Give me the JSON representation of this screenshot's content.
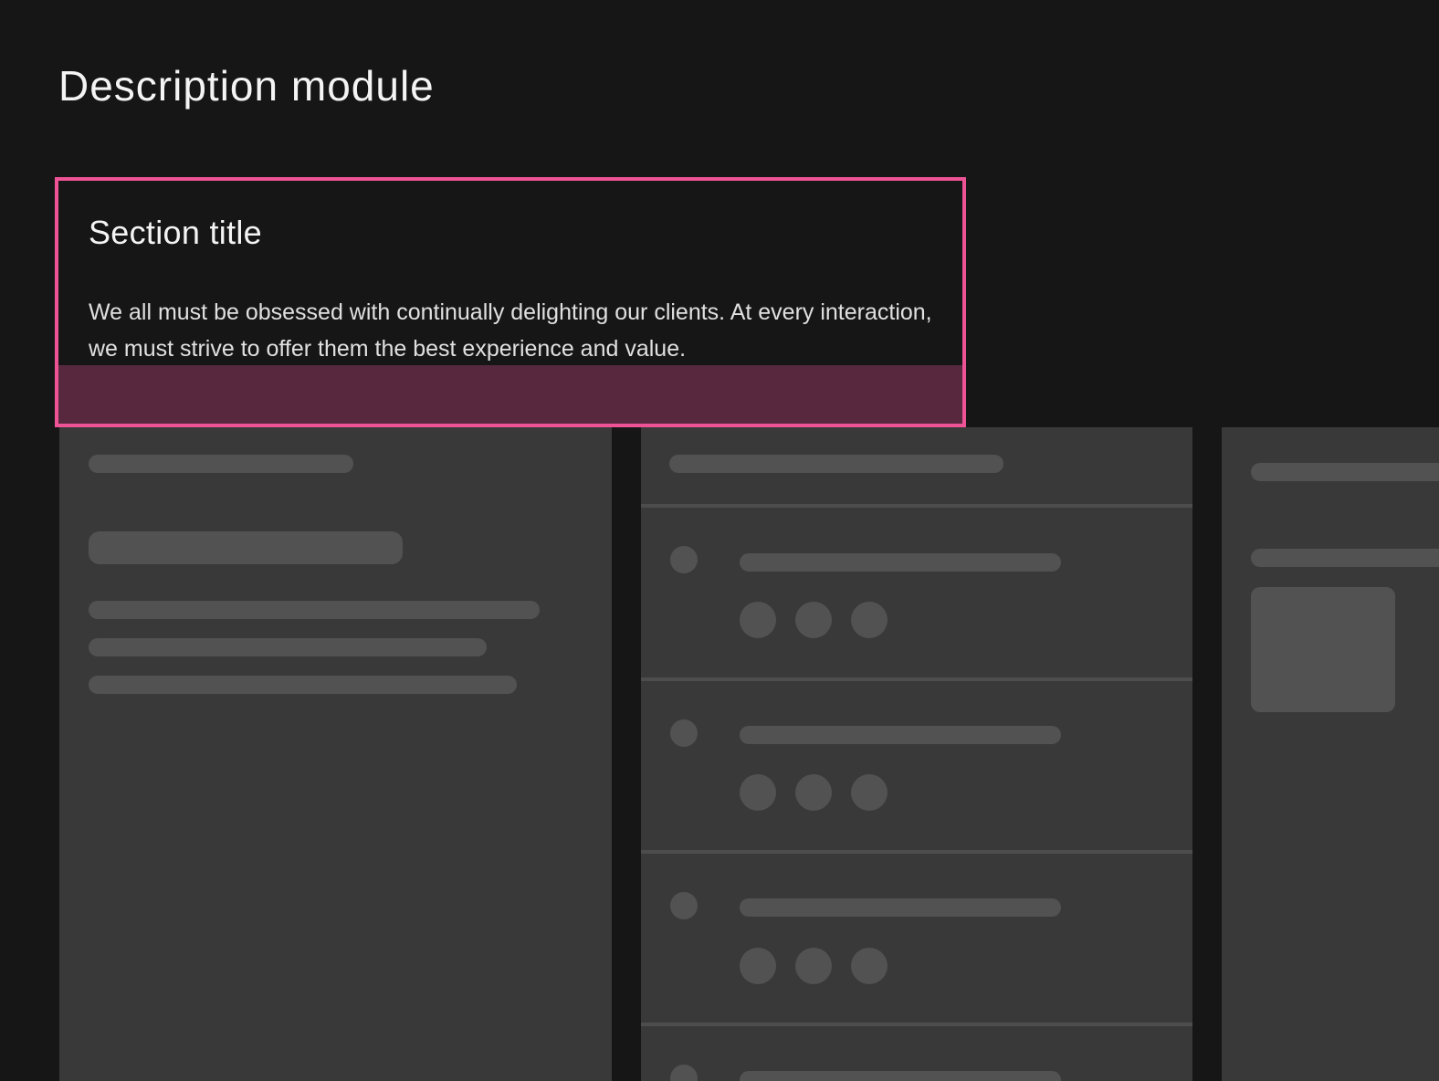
{
  "page": {
    "title": "Description module"
  },
  "module": {
    "section_title": "Section title",
    "body": "We all must be obsessed with continually delighting our clients. At every interaction, we must strive to offer them the best experience and value.",
    "highlight_color": "#ee5396",
    "padding_band_color": "#57283e"
  },
  "colors": {
    "background": "#161616",
    "panel": "#393939",
    "skeleton": "#525252"
  }
}
